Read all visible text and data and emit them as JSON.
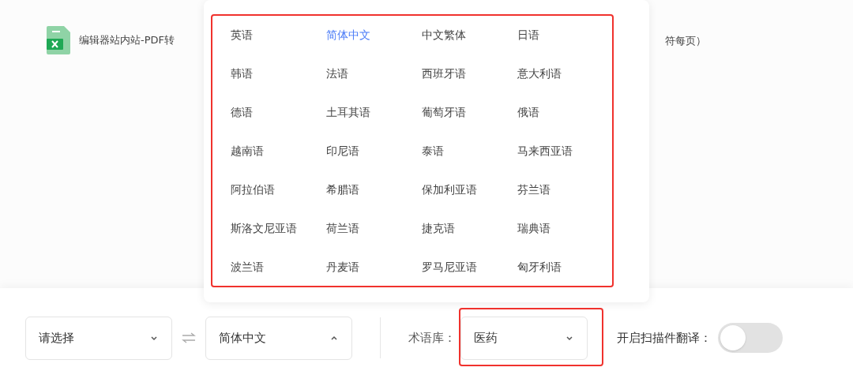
{
  "file": {
    "name": "编辑器站内站-PDF转",
    "name_tail": "符每页）"
  },
  "language_menu": {
    "items": [
      {
        "label": "英语",
        "selected": false
      },
      {
        "label": "简体中文",
        "selected": true
      },
      {
        "label": "中文繁体",
        "selected": false
      },
      {
        "label": "日语",
        "selected": false
      },
      {
        "label": "韩语",
        "selected": false
      },
      {
        "label": "法语",
        "selected": false
      },
      {
        "label": "西班牙语",
        "selected": false
      },
      {
        "label": "意大利语",
        "selected": false
      },
      {
        "label": "德语",
        "selected": false
      },
      {
        "label": "土耳其语",
        "selected": false
      },
      {
        "label": "葡萄牙语",
        "selected": false
      },
      {
        "label": "俄语",
        "selected": false
      },
      {
        "label": "越南语",
        "selected": false
      },
      {
        "label": "印尼语",
        "selected": false
      },
      {
        "label": "泰语",
        "selected": false
      },
      {
        "label": "马来西亚语",
        "selected": false
      },
      {
        "label": "阿拉伯语",
        "selected": false
      },
      {
        "label": "希腊语",
        "selected": false
      },
      {
        "label": "保加利亚语",
        "selected": false
      },
      {
        "label": "芬兰语",
        "selected": false
      },
      {
        "label": "斯洛文尼亚语",
        "selected": false
      },
      {
        "label": "荷兰语",
        "selected": false
      },
      {
        "label": "捷克语",
        "selected": false
      },
      {
        "label": "瑞典语",
        "selected": false
      },
      {
        "label": "波兰语",
        "selected": false
      },
      {
        "label": "丹麦语",
        "selected": false
      },
      {
        "label": "罗马尼亚语",
        "selected": false
      },
      {
        "label": "匈牙利语",
        "selected": false
      }
    ]
  },
  "toolbar": {
    "source_select": {
      "value": "请选择",
      "expanded": false
    },
    "target_select": {
      "value": "简体中文",
      "expanded": true
    },
    "glossary": {
      "label": "术语库：",
      "value": "医药",
      "expanded": false
    },
    "scan_translate": {
      "label": "开启扫描件翻译：",
      "on": false
    }
  }
}
